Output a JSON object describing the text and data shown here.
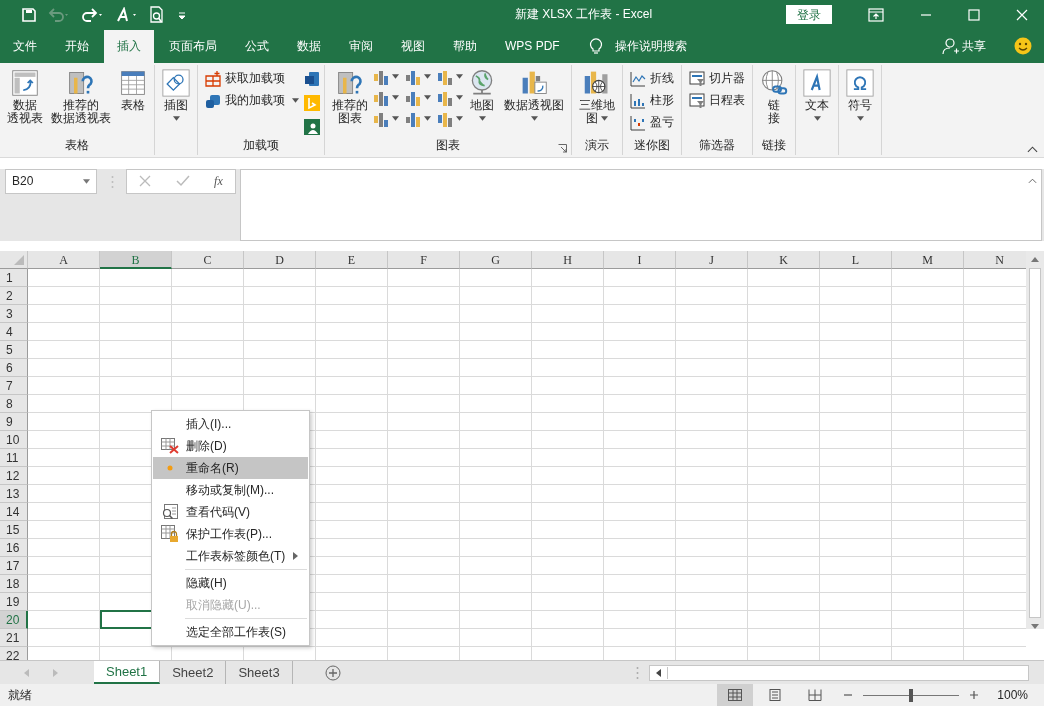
{
  "title_bar": {
    "title": "新建 XLSX 工作表  -  Excel",
    "login": "登录"
  },
  "ribbon_tabs": [
    {
      "label": "文件",
      "selected": false
    },
    {
      "label": "开始",
      "selected": false
    },
    {
      "label": "插入",
      "selected": true
    },
    {
      "label": "页面布局",
      "selected": false
    },
    {
      "label": "公式",
      "selected": false
    },
    {
      "label": "数据",
      "selected": false
    },
    {
      "label": "审阅",
      "selected": false
    },
    {
      "label": "视图",
      "selected": false
    },
    {
      "label": "帮助",
      "selected": false
    },
    {
      "label": "WPS PDF",
      "selected": false
    }
  ],
  "tell_me": "操作说明搜索",
  "share": "共享",
  "ribbon": {
    "groups": [
      {
        "label": "表格",
        "items": [
          {
            "kind": "large",
            "lines": [
              "数据",
              "透视表"
            ]
          },
          {
            "kind": "large",
            "lines": [
              "推荐的",
              "数据透视表"
            ]
          },
          {
            "kind": "large",
            "lines": [
              "表格"
            ]
          }
        ]
      },
      {
        "items": [
          {
            "kind": "large",
            "lines": [
              "插图"
            ],
            "dropdown": true
          }
        ]
      },
      {
        "label": "加载项",
        "items": [
          {
            "kind": "small",
            "entries": [
              {
                "label": "获取加载项",
                "dropdown": false
              },
              {
                "label": "我的加载项",
                "dropdown": true
              }
            ]
          },
          {
            "kind": "addin-icons"
          }
        ]
      },
      {
        "label": "图表",
        "launcher": true,
        "items": [
          {
            "kind": "large",
            "lines": [
              "推荐的",
              "图表"
            ]
          },
          {
            "kind": "chart-icons"
          },
          {
            "kind": "large",
            "lines": [
              "地图"
            ],
            "dropdown": true
          },
          {
            "kind": "large",
            "lines": [
              "数据透视图"
            ],
            "dropdown": true
          }
        ]
      },
      {
        "label": "演示",
        "items": [
          {
            "kind": "large",
            "lines": [
              "三维地",
              "图"
            ],
            "dropdown": true
          }
        ]
      },
      {
        "label": "迷你图",
        "items": [
          {
            "kind": "small",
            "entries": [
              {
                "label": "折线",
                "dropdown": false
              },
              {
                "label": "柱形",
                "dropdown": false
              },
              {
                "label": "盈亏",
                "dropdown": false
              }
            ]
          }
        ]
      },
      {
        "label": "筛选器",
        "items": [
          {
            "kind": "small",
            "entries": [
              {
                "label": "切片器",
                "dropdown": false
              },
              {
                "label": "日程表",
                "dropdown": false
              }
            ]
          }
        ]
      },
      {
        "label": "链接",
        "items": [
          {
            "kind": "large",
            "lines": [
              "链",
              "接"
            ]
          }
        ]
      },
      {
        "items": [
          {
            "kind": "large",
            "lines": [
              "文本"
            ],
            "dropdown": true
          }
        ]
      },
      {
        "items": [
          {
            "kind": "large",
            "lines": [
              "符号"
            ],
            "dropdown": true
          }
        ]
      }
    ]
  },
  "formula_bar": {
    "name_box": "B20",
    "fx": "fx"
  },
  "sheet": {
    "columns": [
      {
        "label": "A",
        "selected": false
      },
      {
        "label": "B",
        "selected": true
      },
      {
        "label": "C",
        "selected": false
      },
      {
        "label": "D",
        "selected": false
      },
      {
        "label": "E",
        "selected": false
      },
      {
        "label": "F",
        "selected": false
      },
      {
        "label": "G",
        "selected": false
      },
      {
        "label": "H",
        "selected": false
      },
      {
        "label": "I",
        "selected": false
      },
      {
        "label": "J",
        "selected": false
      },
      {
        "label": "K",
        "selected": false
      },
      {
        "label": "L",
        "selected": false
      },
      {
        "label": "M",
        "selected": false
      },
      {
        "label": "N",
        "selected": false
      }
    ],
    "rows": [
      {
        "label": "1",
        "selected": false
      },
      {
        "label": "2",
        "selected": false
      },
      {
        "label": "3",
        "selected": false
      },
      {
        "label": "4",
        "selected": false
      },
      {
        "label": "5",
        "selected": false
      },
      {
        "label": "6",
        "selected": false
      },
      {
        "label": "7",
        "selected": false
      },
      {
        "label": "8",
        "selected": false
      },
      {
        "label": "9",
        "selected": false
      },
      {
        "label": "10",
        "selected": false
      },
      {
        "label": "11",
        "selected": false
      },
      {
        "label": "12",
        "selected": false
      },
      {
        "label": "13",
        "selected": false
      },
      {
        "label": "14",
        "selected": false
      },
      {
        "label": "15",
        "selected": false
      },
      {
        "label": "16",
        "selected": false
      },
      {
        "label": "17",
        "selected": false
      },
      {
        "label": "18",
        "selected": false
      },
      {
        "label": "19",
        "selected": false
      },
      {
        "label": "20",
        "selected": true
      },
      {
        "label": "21",
        "selected": false
      },
      {
        "label": "22",
        "selected": false
      }
    ]
  },
  "context_menu": [
    {
      "label": "插入(I)...",
      "kind": "plain",
      "selected": false,
      "disabled": false,
      "submenu": false,
      "separator_before": false
    },
    {
      "label": "删除(D)",
      "kind": "delete",
      "selected": false,
      "disabled": false,
      "submenu": false,
      "separator_before": false
    },
    {
      "label": "重命名(R)",
      "kind": "bullet",
      "selected": true,
      "disabled": false,
      "submenu": false,
      "separator_before": false
    },
    {
      "label": "移动或复制(M)...",
      "kind": "plain",
      "selected": false,
      "disabled": false,
      "submenu": false,
      "separator_before": false
    },
    {
      "label": "查看代码(V)",
      "kind": "code",
      "selected": false,
      "disabled": false,
      "submenu": false,
      "separator_before": false
    },
    {
      "label": "保护工作表(P)...",
      "kind": "protect",
      "selected": false,
      "disabled": false,
      "submenu": false,
      "separator_before": false
    },
    {
      "label": "工作表标签颜色(T)",
      "kind": "plain",
      "selected": false,
      "disabled": false,
      "submenu": true,
      "separator_before": false
    },
    {
      "label": "隐藏(H)",
      "kind": "plain",
      "selected": false,
      "disabled": false,
      "submenu": false,
      "separator_before": true
    },
    {
      "label": "取消隐藏(U)...",
      "kind": "plain",
      "selected": false,
      "disabled": true,
      "submenu": false,
      "separator_before": false
    },
    {
      "label": "选定全部工作表(S)",
      "kind": "plain",
      "selected": false,
      "disabled": false,
      "submenu": false,
      "separator_before": true
    }
  ],
  "sheet_tabs": [
    {
      "label": "Sheet1",
      "selected": true
    },
    {
      "label": "Sheet2",
      "selected": false
    },
    {
      "label": "Sheet3",
      "selected": false
    }
  ],
  "status_bar": {
    "text": "就绪",
    "views": [
      {
        "selected": true
      },
      {
        "selected": false
      },
      {
        "selected": false
      }
    ],
    "zoom": {
      "level": 0.5,
      "reading": "100%"
    }
  }
}
